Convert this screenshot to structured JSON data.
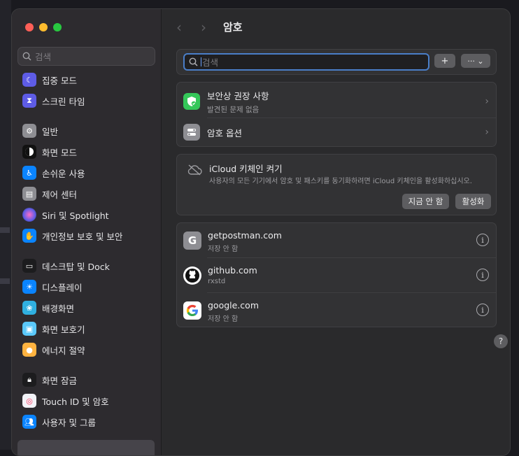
{
  "sidebar": {
    "search_placeholder": "검색",
    "items": [
      {
        "label": "집중 모드",
        "icon": "moon-icon",
        "color": "#5e5ce6"
      },
      {
        "label": "스크린 타임",
        "icon": "hourglass-icon",
        "color": "#5e5ce6"
      },
      {
        "label": "일반",
        "icon": "gear-icon",
        "color": "#8e8e93"
      },
      {
        "label": "화면 모드",
        "icon": "appearance-icon",
        "color": "#1c1c1e"
      },
      {
        "label": "손쉬운 사용",
        "icon": "accessibility-icon",
        "color": "#0a84ff"
      },
      {
        "label": "제어 센터",
        "icon": "control-center-icon",
        "color": "#8e8e93"
      },
      {
        "label": "Siri 및 Spotlight",
        "icon": "siri-icon",
        "color": "#bf5af2"
      },
      {
        "label": "개인정보 보호 및 보안",
        "icon": "hand-icon",
        "color": "#0a84ff"
      },
      {
        "label": "데스크탑 및 Dock",
        "icon": "dock-icon",
        "color": "#1c1c1e"
      },
      {
        "label": "디스플레이",
        "icon": "sun-icon",
        "color": "#0a84ff"
      },
      {
        "label": "배경화면",
        "icon": "flower-icon",
        "color": "#30b0e0"
      },
      {
        "label": "화면 보호기",
        "icon": "screensaver-icon",
        "color": "#5ac8fa"
      },
      {
        "label": "에너지 절약",
        "icon": "bulb-icon",
        "color": "#ffb340"
      },
      {
        "label": "화면 잠금",
        "icon": "lock-icon",
        "color": "#1c1c1e"
      },
      {
        "label": "Touch ID 및 암호",
        "icon": "fingerprint-icon",
        "color": "#f2f2f7"
      },
      {
        "label": "사용자 및 그룹",
        "icon": "users-icon",
        "color": "#0a84ff"
      }
    ]
  },
  "header": {
    "back": "‹",
    "forward": "›",
    "title": "암호"
  },
  "toolbar": {
    "search_placeholder": "검색",
    "add_label": "+",
    "more_label": "··· ⌄"
  },
  "security": {
    "title": "보안상 권장 사항",
    "subtitle": "발견된 문제 없음"
  },
  "options": {
    "title": "암호 옵션"
  },
  "icloud": {
    "title": "iCloud 키체인 켜기",
    "description": "사용자의 모든 기기에서 암호 및 패스키를 동기화하려면 iCloud 키체인을 활성화하십시오.",
    "later_label": "지금 안 함",
    "enable_label": "활성화"
  },
  "passwords": [
    {
      "site": "getpostman.com",
      "account": "저장 안 함",
      "icon_letter": "G",
      "icon": "postman-icon"
    },
    {
      "site": "github.com",
      "account": "rxstd",
      "icon": "github-icon"
    },
    {
      "site": "google.com",
      "account": "저장 안 함",
      "icon": "google-icon"
    }
  ],
  "help_label": "?"
}
